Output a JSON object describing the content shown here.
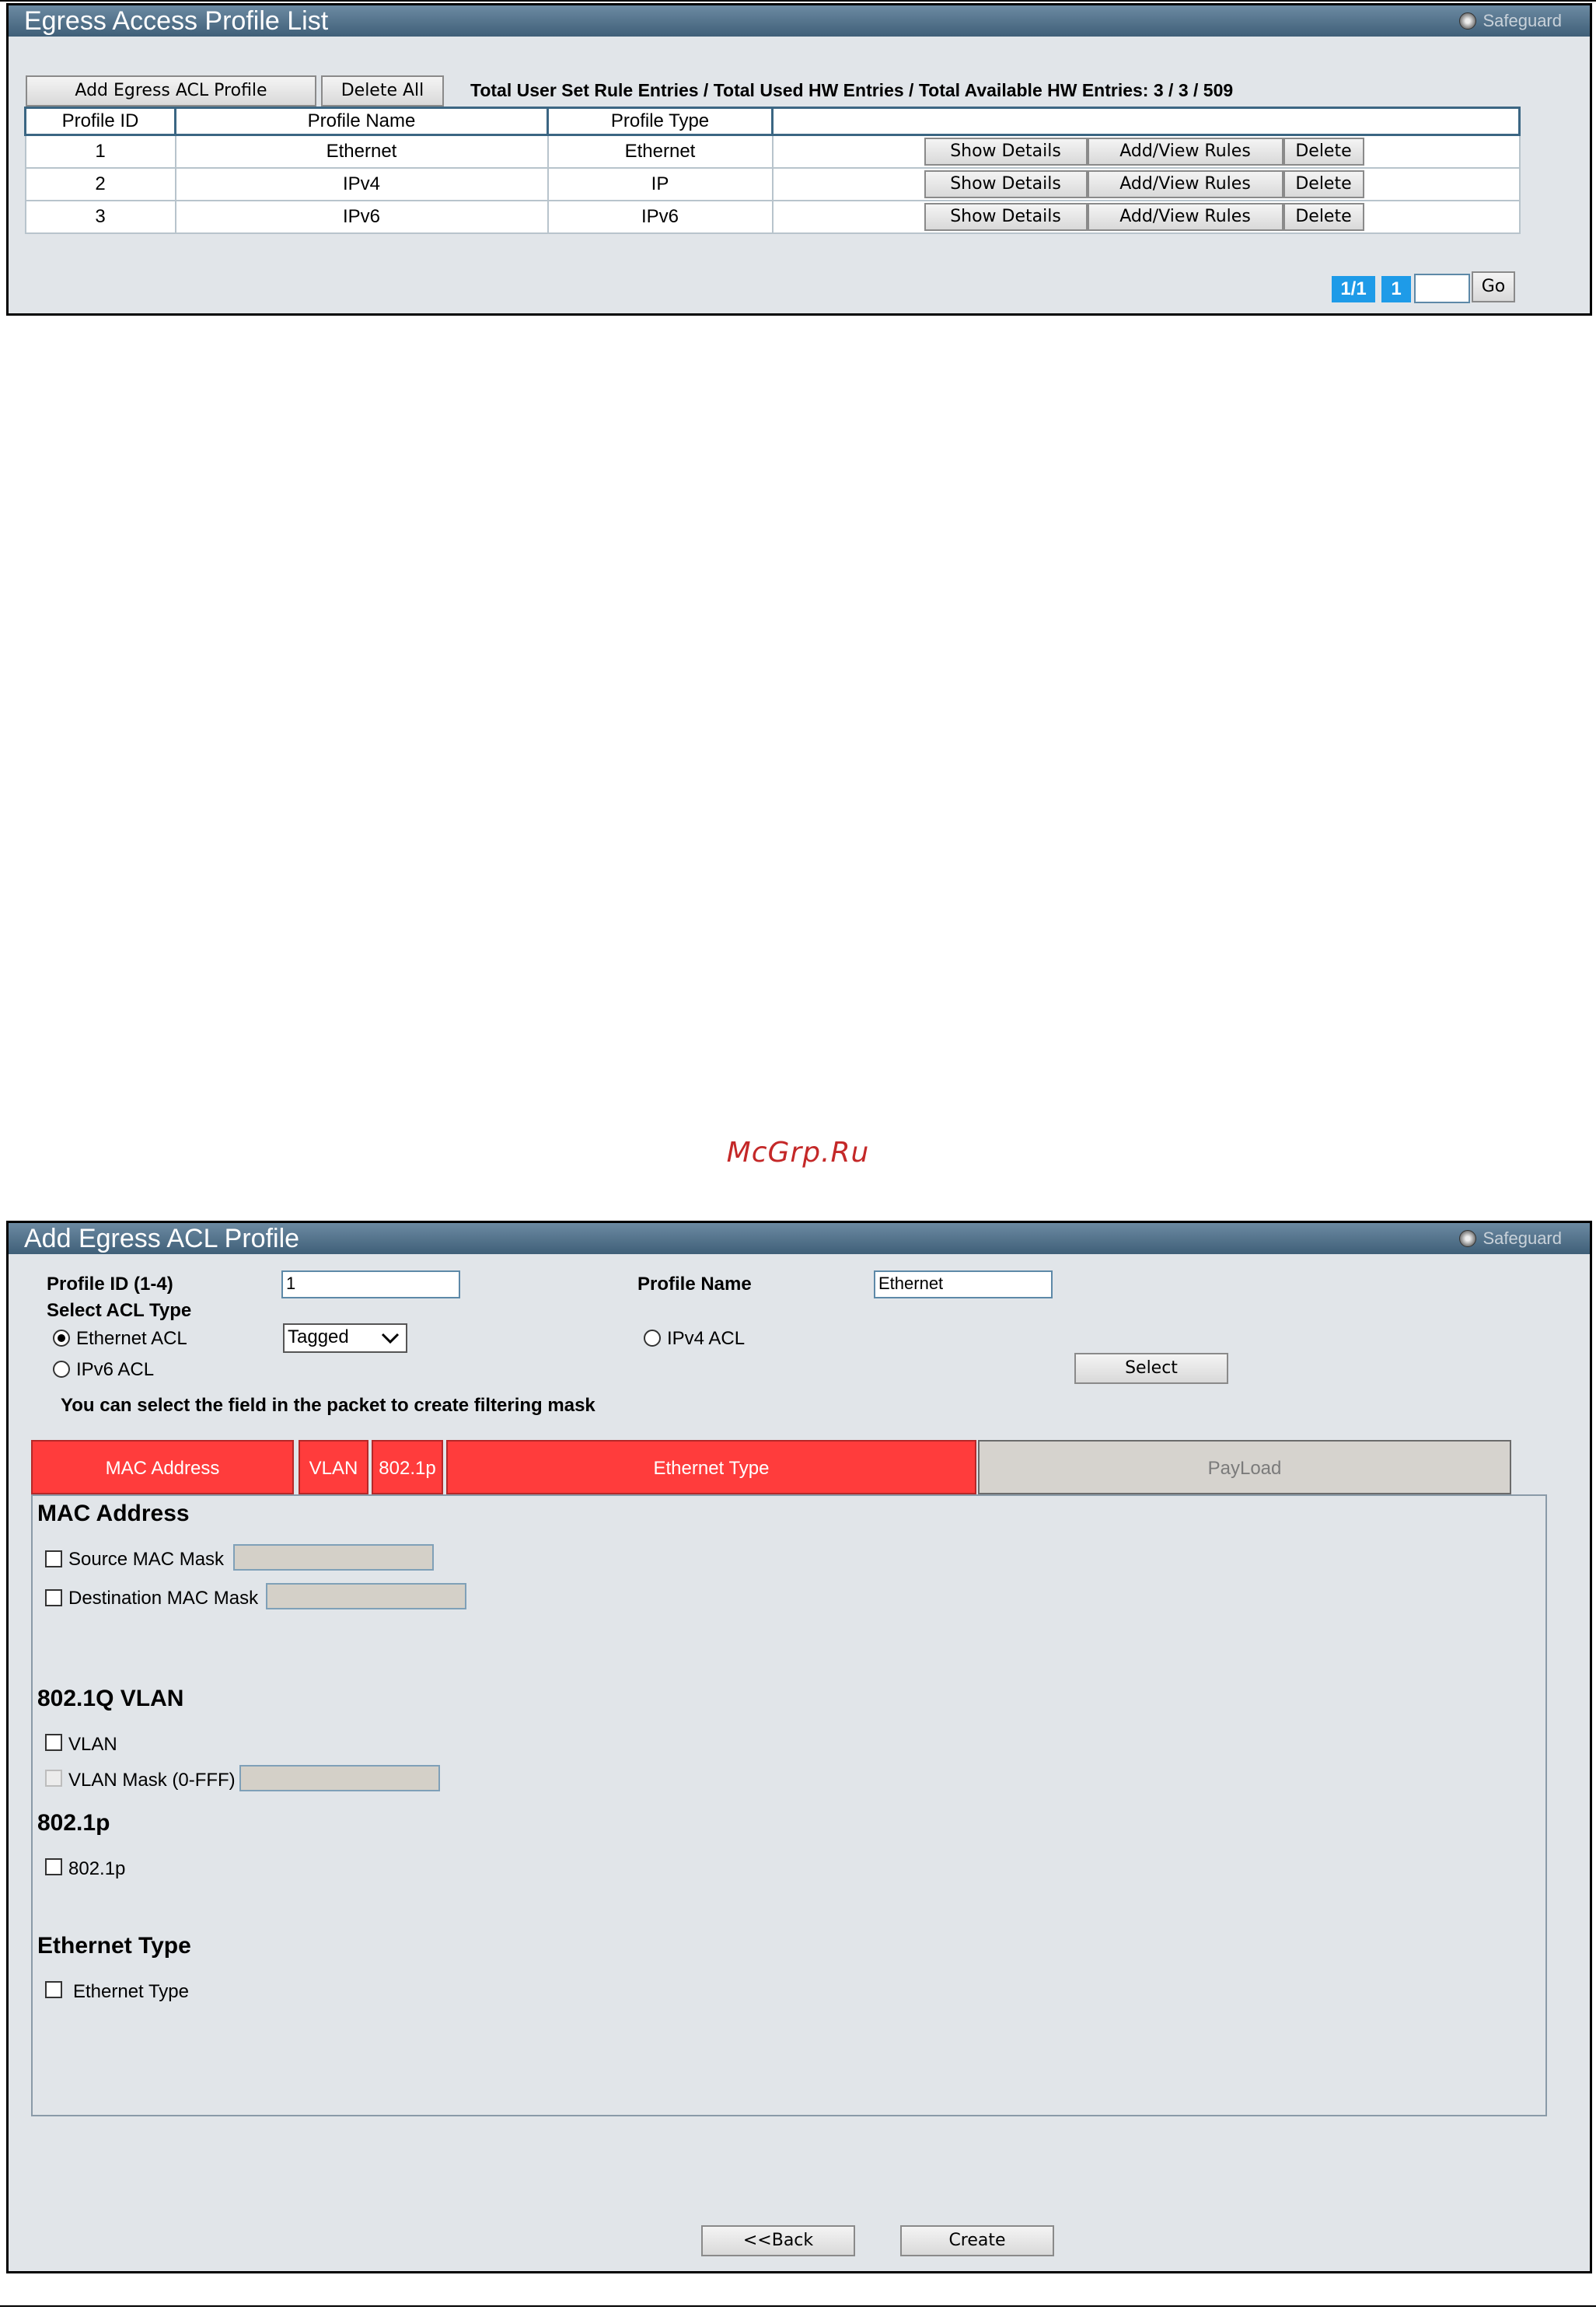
{
  "watermark": "McGrp.Ru",
  "profile_list": {
    "title": "Egress Access Profile List",
    "safeguard": "Safeguard",
    "add_button": "Add Egress ACL Profile",
    "delete_all_button": "Delete All",
    "totals": "Total User Set Rule Entries / Total Used HW Entries / Total Available HW Entries: 3 / 3 / 509",
    "columns": [
      "Profile ID",
      "Profile Name",
      "Profile Type"
    ],
    "rows": [
      {
        "id": "1",
        "name": "Ethernet",
        "type": "Ethernet"
      },
      {
        "id": "2",
        "name": "IPv4",
        "type": "IP"
      },
      {
        "id": "3",
        "name": "IPv6",
        "type": "IPv6"
      }
    ],
    "row_actions": {
      "show": "Show Details",
      "rules": "Add/View Rules",
      "delete": "Delete"
    },
    "pagination": {
      "pages": "1/1",
      "current": "1",
      "go": "Go",
      "page_input": ""
    }
  },
  "add_profile": {
    "title": "Add Egress ACL Profile",
    "safeguard": "Safeguard",
    "profile_id_label": "Profile ID (1-4)",
    "profile_id_value": "1",
    "profile_name_label": "Profile Name",
    "profile_name_value": "Ethernet",
    "acl_type_label": "Select ACL Type",
    "ethernet_acl": "Ethernet ACL",
    "ethernet_acl_checked": true,
    "tag_select": "Tagged",
    "ipv4_acl": "IPv4 ACL",
    "ipv6_acl": "IPv6 ACL",
    "select_button": "Select",
    "hint": "You can select the field in the packet to create filtering mask",
    "tabs": [
      "MAC Address",
      "VLAN",
      "802.1p",
      "Ethernet Type",
      "PayLoad"
    ],
    "mac_section": "MAC Address",
    "source_mac": "Source MAC Mask",
    "dest_mac": "Destination MAC Mask",
    "vlan_section": "802.1Q VLAN",
    "vlan": "VLAN",
    "vlan_mask": "VLAN Mask (0-FFF)",
    "p_section": "802.1p",
    "p_item": "802.1p",
    "etype_section": "Ethernet Type",
    "etype_item": "Ethernet Type",
    "back_button": "<<Back",
    "create_button": "Create"
  }
}
